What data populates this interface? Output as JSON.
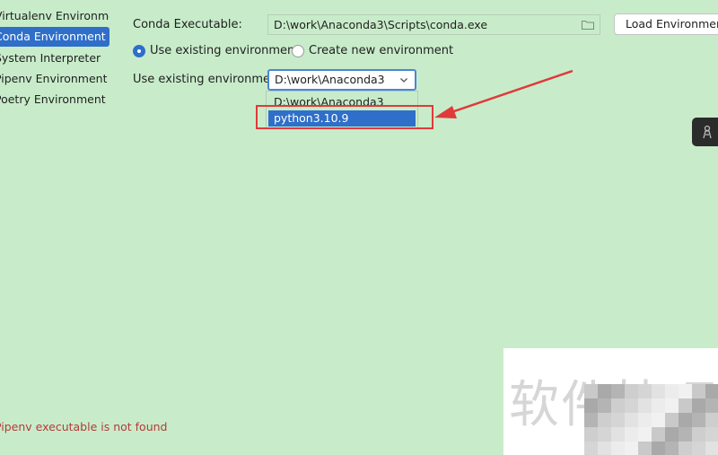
{
  "sidebar": {
    "items": [
      {
        "label": "Virtualenv Environment",
        "selected": false
      },
      {
        "label": "Conda Environment",
        "selected": true
      },
      {
        "label": "System Interpreter",
        "selected": false
      },
      {
        "label": "Pipenv Environment",
        "selected": false
      },
      {
        "label": "Poetry Environment",
        "selected": false
      }
    ]
  },
  "form": {
    "conda_label": "Conda Executable:",
    "conda_path": "D:\\work\\Anaconda3\\Scripts\\conda.exe",
    "load_button": "Load Environments",
    "radio_use_existing": "Use existing environment",
    "radio_create_new": "Create new environment",
    "existing_label": "Use existing environment:",
    "selected_env": "D:\\work\\Anaconda3",
    "options": [
      "D:\\work\\Anaconda3",
      "python3.10.9"
    ]
  },
  "status": {
    "error": "Pipenv executable is not found"
  },
  "watermark": {
    "text": "软件技巧"
  },
  "colors": {
    "background": "#c8ecca",
    "accent": "#2f6fc9",
    "annotation": "#e03a3a",
    "error": "#b23b3b"
  }
}
